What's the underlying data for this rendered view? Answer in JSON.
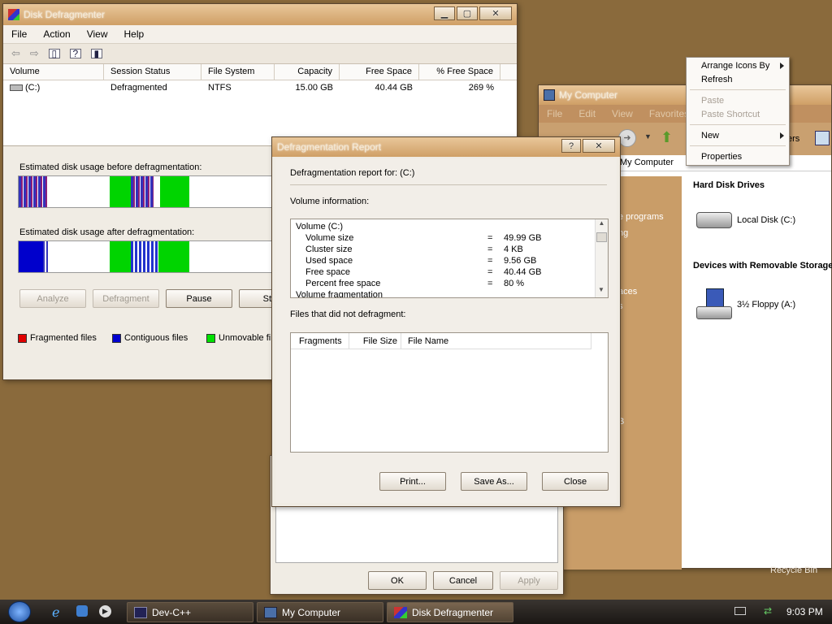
{
  "disk_defrag": {
    "title": "Disk Defragmenter",
    "menu": [
      "File",
      "Action",
      "View",
      "Help"
    ],
    "columns": [
      "Volume",
      "Session Status",
      "File System",
      "Capacity",
      "Free Space",
      "% Free Space"
    ],
    "row": {
      "volume": "(C:)",
      "status": "Defragmented",
      "fs": "NTFS",
      "capacity": "15.00 GB",
      "free": "40.44 GB",
      "pct": "269 %"
    },
    "before_label": "Estimated disk usage before defragmentation:",
    "after_label": "Estimated disk usage after defragmentation:",
    "buttons": {
      "analyze": "Analyze",
      "defragment": "Defragment",
      "pause": "Pause",
      "stop": "Stop"
    },
    "legend": {
      "fragmented": "Fragmented files",
      "contiguous": "Contiguous files",
      "unmovable": "Unmovable files"
    },
    "colors": {
      "fragmented": "#e00000",
      "contiguous": "#0000d0",
      "unmovable": "#00e000",
      "free": "#ffffff"
    }
  },
  "report": {
    "title": "Defragmentation Report",
    "report_for": "Defragmentation report for:  (C:)",
    "volume_info_label": "Volume information:",
    "info_lines": [
      {
        "label": "Volume  (C:)",
        "value": "",
        "indent": false
      },
      {
        "label": "Volume size",
        "value": "49.99 GB",
        "indent": true
      },
      {
        "label": "Cluster size",
        "value": "4 KB",
        "indent": true
      },
      {
        "label": "Used space",
        "value": "9.56 GB",
        "indent": true
      },
      {
        "label": "Free space",
        "value": "40.44 GB",
        "indent": true
      },
      {
        "label": "Percent free space",
        "value": "80 %",
        "indent": true
      },
      {
        "label": "Volume fragmentation",
        "value": "",
        "indent": false
      }
    ],
    "eq": "=",
    "not_defrag_label": "Files that did not defragment:",
    "columns": [
      "Fragments",
      "File Size",
      "File Name"
    ],
    "buttons": {
      "print": "Print...",
      "save_as": "Save As...",
      "close": "Close"
    }
  },
  "bg_dialog": {
    "ok": "OK",
    "cancel": "Cancel",
    "apply": "Apply"
  },
  "my_computer": {
    "title": "My Computer",
    "menu": [
      "File",
      "Edit",
      "View",
      "Favorites"
    ],
    "address": "My Computer",
    "hard_disk_header": "Hard Disk Drives",
    "local_disk": "Local Disk (C:)",
    "removable_header": "Devices with Removable Storage",
    "floppy": "3½ Floppy (A:)",
    "sidebar_fragments": [
      "e programs",
      "ng",
      "aces",
      "s",
      "B"
    ],
    "toolbar_frag": "ers",
    "recycle": "Recycle Bin"
  },
  "context_menu": {
    "items": [
      {
        "label": "Arrange Icons By",
        "disabled": false,
        "submenu": true
      },
      {
        "label": "Refresh",
        "disabled": false,
        "submenu": false
      },
      {
        "label": "Paste",
        "disabled": true,
        "submenu": false
      },
      {
        "label": "Paste Shortcut",
        "disabled": true,
        "submenu": false
      },
      {
        "label": "New",
        "disabled": false,
        "submenu": true
      },
      {
        "label": "Properties",
        "disabled": false,
        "submenu": false
      }
    ]
  },
  "taskbar": {
    "items": [
      "Dev-C++",
      "My Computer",
      "Disk Defragmenter"
    ],
    "active": "Disk Defragmenter",
    "clock": "9:03 PM"
  }
}
